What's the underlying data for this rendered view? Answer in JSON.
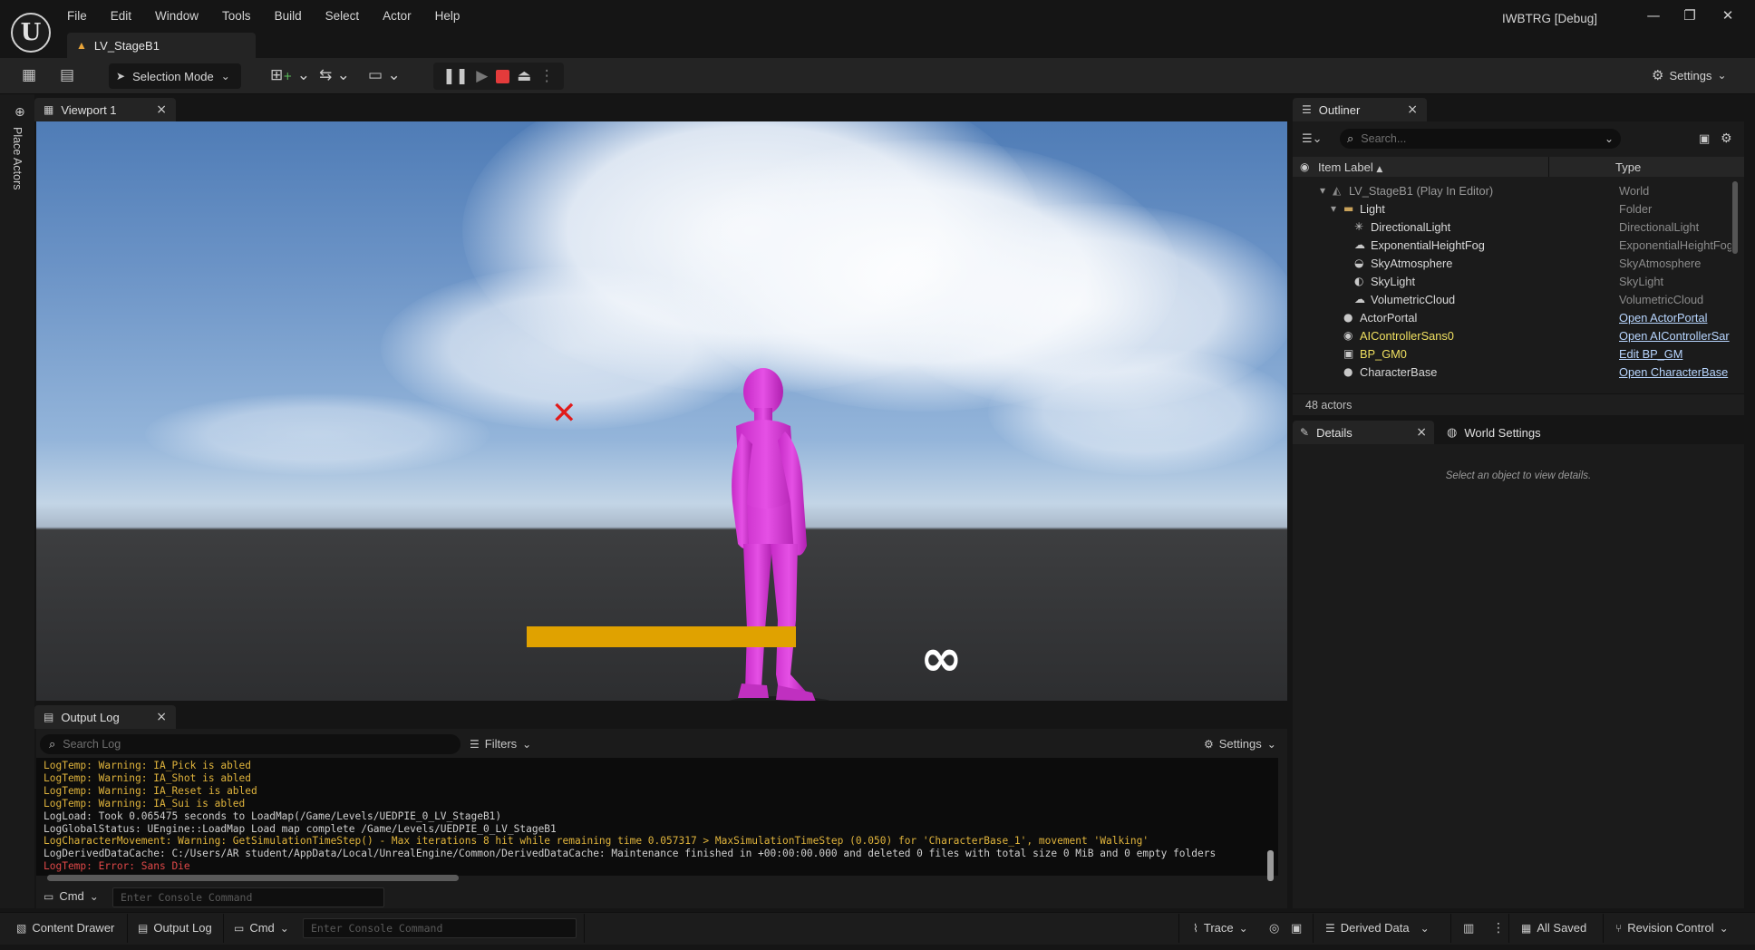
{
  "app": {
    "window_title": "IWBTRG [Debug]",
    "menu": [
      "File",
      "Edit",
      "Window",
      "Tools",
      "Build",
      "Select",
      "Actor",
      "Help"
    ],
    "level_tab": "LV_StageB1",
    "logo_letter": "U"
  },
  "toolbar": {
    "selection_mode": "Selection Mode",
    "settings": "Settings"
  },
  "left_bar": {
    "place_actors": "Place Actors"
  },
  "viewport": {
    "tab": "Viewport 1",
    "hud_infinity": "∞"
  },
  "output_log": {
    "tab": "Output Log",
    "search_placeholder": "Search Log",
    "filters": "Filters",
    "settings": "Settings",
    "lines": [
      {
        "text": "LogTemp: Warning: IA_Pick is abled",
        "level": "warning"
      },
      {
        "text": "LogTemp: Warning: IA_Shot is abled",
        "level": "warning"
      },
      {
        "text": "LogTemp: Warning: IA_Reset is abled",
        "level": "warning"
      },
      {
        "text": "LogTemp: Warning: IA_Sui is abled",
        "level": "warning"
      },
      {
        "text": "LogLoad: Took 0.065475 seconds to LoadMap(/Game/Levels/UEDPIE_0_LV_StageB1)",
        "level": "info"
      },
      {
        "text": "LogGlobalStatus: UEngine::LoadMap Load map complete /Game/Levels/UEDPIE_0_LV_StageB1",
        "level": "info"
      },
      {
        "text": "LogCharacterMovement: Warning: GetSimulationTimeStep() - Max iterations 8 hit while remaining time 0.057317 > MaxSimulationTimeStep (0.050) for 'CharacterBase_1', movement 'Walking'",
        "level": "warning"
      },
      {
        "text": "LogDerivedDataCache: C:/Users/AR student/AppData/Local/UnrealEngine/Common/DerivedDataCache: Maintenance finished in +00:00:00.000 and deleted 0 files with total size 0 MiB and 0 empty folders",
        "level": "info"
      },
      {
        "text": "LogTemp: Error: Sans Die",
        "level": "error"
      }
    ],
    "cmd_label": "Cmd",
    "console_placeholder": "Enter Console Command"
  },
  "outliner": {
    "tab": "Outliner",
    "search_placeholder": "Search...",
    "col_label": "Item Label",
    "col_type": "Type",
    "rows": [
      {
        "label": "LV_StageB1 (Play In Editor)",
        "type": "World",
        "link": false,
        "indent": 0,
        "icon": "level-icon",
        "glyph": "◭",
        "arrow": "▾",
        "dim": true
      },
      {
        "label": "Light",
        "type": "Folder",
        "link": false,
        "indent": 1,
        "icon": "folder-icon",
        "glyph": "▬",
        "arrow": "▾",
        "dim": false
      },
      {
        "label": "DirectionalLight",
        "type": "DirectionalLight",
        "link": false,
        "indent": 2,
        "icon": "directional-light-icon",
        "glyph": "✳",
        "arrow": "",
        "dim": false
      },
      {
        "label": "ExponentialHeightFog",
        "type": "ExponentialHeightFog",
        "link": false,
        "indent": 2,
        "icon": "fog-icon",
        "glyph": "☁",
        "arrow": "",
        "dim": false
      },
      {
        "label": "SkyAtmosphere",
        "type": "SkyAtmosphere",
        "link": false,
        "indent": 2,
        "icon": "sky-atmosphere-icon",
        "glyph": "◒",
        "arrow": "",
        "dim": false
      },
      {
        "label": "SkyLight",
        "type": "SkyLight",
        "link": false,
        "indent": 2,
        "icon": "skylight-icon",
        "glyph": "◐",
        "arrow": "",
        "dim": false
      },
      {
        "label": "VolumetricCloud",
        "type": "VolumetricCloud",
        "link": false,
        "indent": 2,
        "icon": "cloud-icon",
        "glyph": "☁",
        "arrow": "",
        "dim": false
      },
      {
        "label": "ActorPortal",
        "type": "Open ActorPortal",
        "link": true,
        "indent": 1,
        "icon": "actor-icon",
        "glyph": "●",
        "arrow": "",
        "dim": false
      },
      {
        "label": "AIControllerSans0",
        "type": "Open AIControllerSar",
        "link": true,
        "indent": 1,
        "icon": "controller-icon",
        "glyph": "◉",
        "arrow": "",
        "dim": false,
        "highlight": true
      },
      {
        "label": "BP_GM0",
        "type": "Edit BP_GM",
        "link": true,
        "indent": 1,
        "icon": "gamemode-icon",
        "glyph": "▣",
        "arrow": "",
        "dim": false,
        "highlight": true
      },
      {
        "label": "CharacterBase",
        "type": "Open CharacterBase",
        "link": true,
        "indent": 1,
        "icon": "character-icon",
        "glyph": "●",
        "arrow": "",
        "dim": false
      }
    ],
    "actor_count": "48 actors"
  },
  "details": {
    "tab": "Details",
    "world_tab": "World Settings",
    "empty_text": "Select an object to view details."
  },
  "statusbar": {
    "content_drawer": "Content Drawer",
    "output_log": "Output Log",
    "cmd": "Cmd",
    "console_placeholder": "Enter Console Command",
    "trace": "Trace",
    "derived_data": "Derived Data",
    "all_saved": "All Saved",
    "revision_control": "Revision Control"
  },
  "colors": {
    "warning": "#e0b43c",
    "error": "#e04848",
    "info": "#cfcfcf",
    "character": "#e03ce0",
    "platform": "#e0a200",
    "stop": "#e33b3b"
  }
}
